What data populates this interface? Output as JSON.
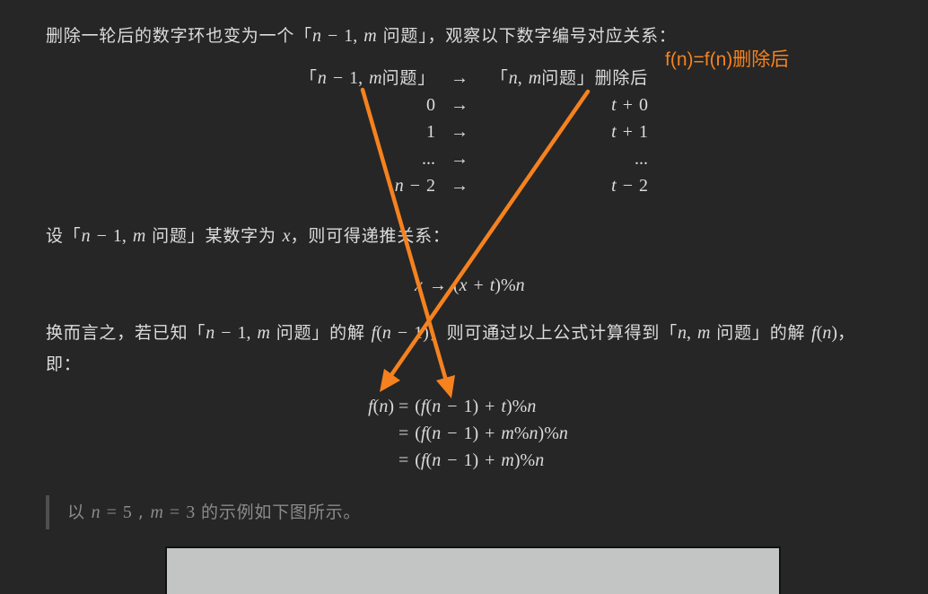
{
  "colors": {
    "background": "#262626",
    "text": "#dcdcdc",
    "quote_text": "#8b8b8b",
    "quote_bar": "#4f4f4f",
    "annotation": "#f5821f",
    "figure_fill": "#c3c5c4"
  },
  "intro": {
    "before": "删除一轮后的数字环也变为一个「",
    "math": "n − 1, m",
    "after": " 问题」，观察以下数字编号对应关系："
  },
  "mapping_table": {
    "header": {
      "left_open": "「",
      "left_math": "n − 1, m",
      "left_close": "问题」",
      "arrow": "→",
      "right_open": "「",
      "right_math": "n, m",
      "right_close": "问题」删除后"
    },
    "rows": [
      {
        "left": "0",
        "arrow": "→",
        "right": "t + 0"
      },
      {
        "left": "1",
        "arrow": "→",
        "right": "t + 1"
      },
      {
        "left": "...",
        "arrow": "→",
        "right": "..."
      },
      {
        "left": "n − 2",
        "arrow": "→",
        "right": "t − 2"
      }
    ]
  },
  "annotation": {
    "label": "f(n)=f(n)删除后"
  },
  "recurrence_intro": {
    "before": "设「",
    "math": "n − 1, m",
    "middle": " 问题」某数字为 ",
    "var": "x",
    "after": "，则可得递推关系："
  },
  "recurrence_formula": "x → (x + t)%n",
  "conclusion": {
    "part1": "换而言之，若已知「",
    "math1": "n − 1, m",
    "part2": " 问题」的解 ",
    "math2": "f(n − 1)",
    "part3": "，则可通过以上公式计算得到「",
    "math3": "n, m",
    "part4": " 问题」的解 ",
    "math4": "f(n)",
    "part5": "，",
    "line2": "即："
  },
  "equations": [
    {
      "lhs": "f(n)",
      "rhs": "= (f(n − 1) + t)%n"
    },
    {
      "rhs": "= (f(n − 1) + m%n)%n"
    },
    {
      "rhs": "= (f(n − 1) + m)%n"
    }
  ],
  "quote": {
    "before": "以 ",
    "math1": "n = 5",
    "middle": " , ",
    "math2": "m = 3",
    "after": " 的示例如下图所示。"
  }
}
